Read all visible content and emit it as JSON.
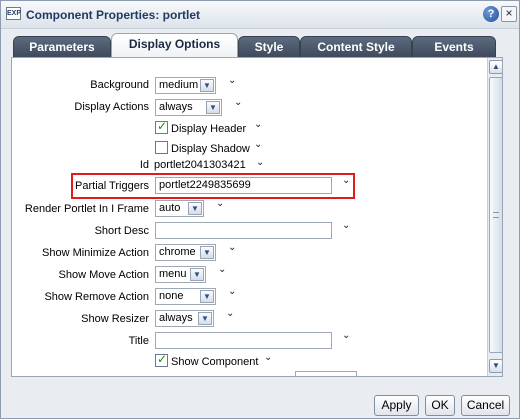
{
  "window": {
    "icon_text": "EXP",
    "title": "Component Properties: portlet",
    "help_glyph": "?",
    "close_glyph": "×"
  },
  "tabs": [
    {
      "label": "Parameters",
      "active": false
    },
    {
      "label": "Display Options",
      "active": true
    },
    {
      "label": "Style",
      "active": false
    },
    {
      "label": "Content Style",
      "active": false
    },
    {
      "label": "Events",
      "active": false
    }
  ],
  "form": {
    "background": {
      "label": "Background",
      "value": "medium"
    },
    "display_actions": {
      "label": "Display Actions",
      "value": "always"
    },
    "display_header": {
      "label": "Display Header",
      "checked": true
    },
    "display_shadow": {
      "label": "Display Shadow",
      "checked": false
    },
    "id": {
      "label": "Id",
      "value": "portlet2041303421"
    },
    "partial_triggers": {
      "label": "Partial Triggers",
      "value": "portlet2249835699"
    },
    "render_portlet": {
      "label": "Render Portlet In I Frame",
      "value": "auto"
    },
    "short_desc": {
      "label": "Short Desc",
      "value": ""
    },
    "show_minimize": {
      "label": "Show Minimize Action",
      "value": "chrome"
    },
    "show_move": {
      "label": "Show Move Action",
      "value": "menu"
    },
    "show_remove": {
      "label": "Show Remove Action",
      "value": "none"
    },
    "show_resizer": {
      "label": "Show Resizer",
      "value": "always"
    },
    "title": {
      "label": "Title",
      "value": ""
    },
    "show_component": {
      "label": "Show Component",
      "checked": true
    }
  },
  "glyphs": {
    "chevron": "⌄",
    "arrow_down": "▼",
    "arrow_up": "▲"
  },
  "colors": {
    "highlight_border": "#e21b1b",
    "tab_active_text": "#1c2a40",
    "tab_inactive_bg": "#4b5769"
  },
  "footer": {
    "apply": "Apply",
    "ok": "OK",
    "cancel": "Cancel"
  }
}
